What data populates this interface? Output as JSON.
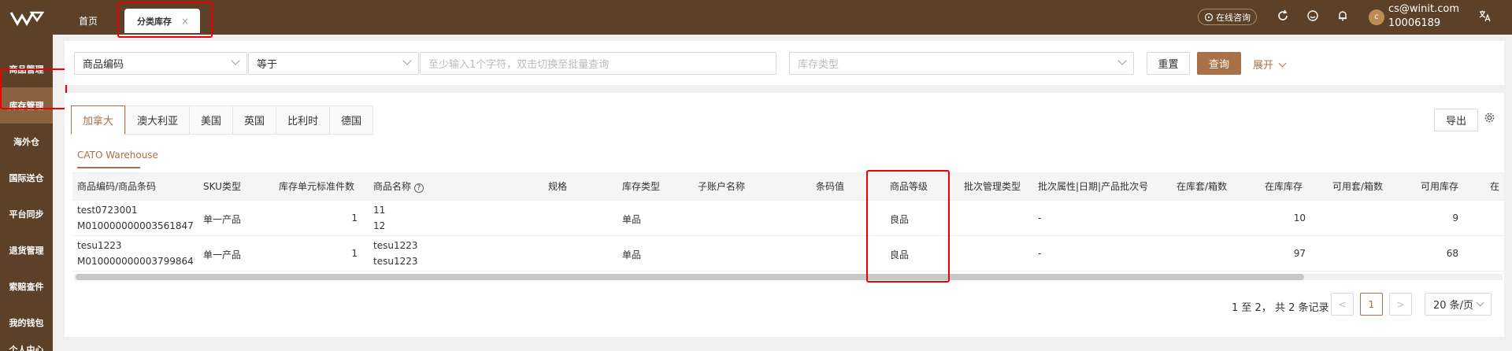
{
  "topbar": {
    "home_tab": "首页",
    "active_tab": "分类库存",
    "close_glyph": "×",
    "online_label": "在线咨询",
    "user_email": "cs@winit.com",
    "user_id": "10006189",
    "avatar_initial": "c"
  },
  "sidebar": {
    "items": [
      "商品管理",
      "库存管理",
      "海外仓",
      "国际送仓",
      "平台同步",
      "退货管理",
      "索赔查件",
      "我的钱包",
      "个人中心"
    ]
  },
  "filters": {
    "field_select": "商品编码",
    "operator_select": "等于",
    "value_placeholder": "至少输入1个字符，双击切换至批量查询",
    "stock_type_placeholder": "库存类型",
    "reset_label": "重置",
    "query_label": "查询",
    "expand_label": "展开"
  },
  "country_tabs": [
    "加拿大",
    "澳大利亚",
    "美国",
    "英国",
    "比利时",
    "德国"
  ],
  "export_label": "导出",
  "warehouse_label": "CATO Warehouse",
  "table": {
    "headers": [
      "商品编码/商品条码",
      "SKU类型",
      "库存单元标准件数",
      "商品名称",
      "规格",
      "库存类型",
      "子账户名称",
      "条码值",
      "商品等级",
      "批次管理类型",
      "批次属性|日期|产品批次号",
      "在库套/箱数",
      "在库库存",
      "可用套/箱数",
      "可用库存",
      "在"
    ],
    "rows": [
      {
        "code": "test0723001",
        "barcode": "M010000000003561847",
        "sku_type": "单一产品",
        "std_units": "1",
        "name1": "11",
        "name2": "12",
        "stock_type": "单品",
        "grade": "良品",
        "batch_attr": "-",
        "in_stock": "10",
        "available": "9"
      },
      {
        "code": "tesu1223",
        "barcode": "M010000000003799864",
        "sku_type": "单一产品",
        "std_units": "1",
        "name1": "tesu1223",
        "name2": "tesu1223",
        "stock_type": "单品",
        "grade": "良品",
        "batch_attr": "-",
        "in_stock": "97",
        "available": "68"
      }
    ]
  },
  "pagination": {
    "info": "1 至 2， 共 2 条记录",
    "prev": "<",
    "current": "1",
    "next": ">",
    "page_size": "20 条/页"
  },
  "colors": {
    "brand_dark": "#5c4028",
    "accent": "#a87147",
    "highlight_box": "#e00000"
  }
}
